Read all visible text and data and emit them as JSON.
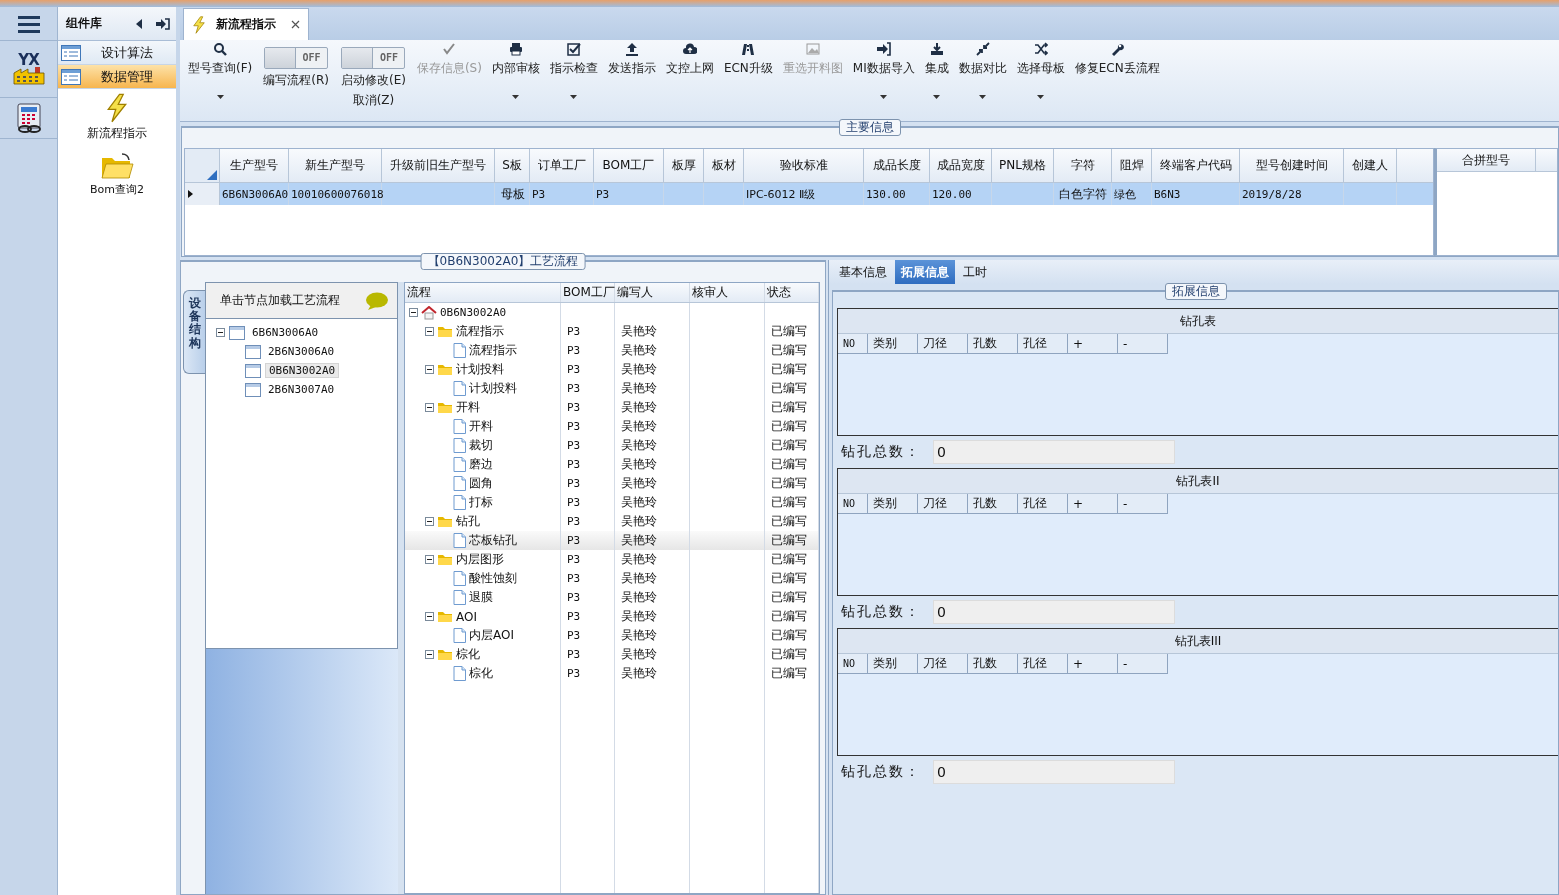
{
  "rail": {
    "logo_text": "YX"
  },
  "component_panel": {
    "title": "组件库",
    "items": [
      {
        "label": "设计算法",
        "selected": false
      },
      {
        "label": "数据管理",
        "selected": true
      }
    ],
    "shortcuts": [
      {
        "label": "新流程指示",
        "kind": "bolt"
      },
      {
        "label": "Bom查询2",
        "kind": "folder"
      }
    ]
  },
  "doc_tabs": [
    {
      "label": "新流程指示",
      "selected": true
    }
  ],
  "toolbar": {
    "items": [
      {
        "kind": "button",
        "label": "型号查询(F)",
        "dropdown": true,
        "disabled": false
      },
      {
        "kind": "toggle",
        "toggle_text": "OFF",
        "on": false,
        "lines": [
          "编写流程(R)"
        ]
      },
      {
        "kind": "toggle",
        "toggle_text": "OFF",
        "on": false,
        "lines": [
          "启动修改(E)",
          "取消(Z)"
        ]
      },
      {
        "kind": "button",
        "label": "保存信息(S)",
        "dropdown": false,
        "disabled": true
      },
      {
        "kind": "button",
        "label": "内部审核",
        "dropdown": true,
        "disabled": false
      },
      {
        "kind": "button",
        "label": "指示检查",
        "dropdown": true,
        "disabled": false
      },
      {
        "kind": "button",
        "label": "发送指示",
        "dropdown": false,
        "disabled": false
      },
      {
        "kind": "button",
        "label": "文控上网",
        "dropdown": false,
        "disabled": false
      },
      {
        "kind": "button",
        "label": "ECN升级",
        "dropdown": false,
        "disabled": false
      },
      {
        "kind": "button",
        "label": "重选开料图",
        "dropdown": false,
        "disabled": true
      },
      {
        "kind": "button",
        "label": "MI数据导入",
        "dropdown": true,
        "disabled": false
      },
      {
        "kind": "button",
        "label": "集成",
        "dropdown": true,
        "disabled": false
      },
      {
        "kind": "button",
        "label": "数据对比",
        "dropdown": true,
        "disabled": false
      },
      {
        "kind": "button",
        "label": "选择母板",
        "dropdown": true,
        "disabled": false
      },
      {
        "kind": "button",
        "label": "修复ECN丢流程",
        "dropdown": false,
        "disabled": false
      }
    ]
  },
  "main_info": {
    "title": "主要信息",
    "columns": [
      "生产型号",
      "新生产型号",
      "升级前旧生产型号",
      "S板",
      "订单工厂",
      "BOM工厂",
      "板厚",
      "板材",
      "验收标准",
      "成品长度",
      "成品宽度",
      "PNL规格",
      "字符",
      "阻焊",
      "终端客户代码",
      "型号创建时间",
      "创建人"
    ],
    "rows": [
      {
        "selected": true,
        "cells": [
          "6B6N3006A0",
          "10010600076018",
          null,
          "母板",
          "P3",
          "P3",
          null,
          null,
          "IPC-6012 Ⅱ级",
          "130.00",
          "120.00",
          null,
          "白色字符",
          "绿色",
          "B6N3",
          "2019/8/28",
          null
        ]
      }
    ],
    "side_columns": [
      "合拼型号"
    ]
  },
  "flow_group": {
    "title": "【0B6N3002A0】工艺流程",
    "side_tab": "设备结构",
    "device_tree": {
      "hint": "单击节点加载工艺流程",
      "nodes": [
        {
          "label": "6B6N3006A0",
          "expanded": true,
          "selected": false,
          "children": [
            {
              "label": "2B6N3006A0",
              "selected": false
            },
            {
              "label": "0B6N3002A0",
              "selected": true
            },
            {
              "label": "2B6N3007A0",
              "selected": false
            }
          ]
        }
      ]
    },
    "flow_table": {
      "columns": [
        "流程",
        "BOM工厂",
        "编写人",
        "核审人",
        "状态"
      ],
      "nodes": [
        {
          "kind": "root",
          "label": "0B6N3002A0",
          "expanded": true,
          "selected": false,
          "children": [
            {
              "kind": "folder",
              "label": "流程指示",
              "bom": "P3",
              "writer": "吴艳玲",
              "status": "已编写",
              "expanded": true,
              "selected": false,
              "children": [
                {
                  "kind": "step",
                  "label": "流程指示",
                  "bom": "P3",
                  "writer": "吴艳玲",
                  "status": "已编写",
                  "selected": false
                }
              ]
            },
            {
              "kind": "folder",
              "label": "计划投料",
              "bom": "P3",
              "writer": "吴艳玲",
              "status": "已编写",
              "expanded": true,
              "selected": false,
              "children": [
                {
                  "kind": "step",
                  "label": "计划投料",
                  "bom": "P3",
                  "writer": "吴艳玲",
                  "status": "已编写",
                  "selected": false
                }
              ]
            },
            {
              "kind": "folder",
              "label": "开料",
              "bom": "P3",
              "writer": "吴艳玲",
              "status": "已编写",
              "expanded": true,
              "selected": false,
              "children": [
                {
                  "kind": "step",
                  "label": "开料",
                  "bom": "P3",
                  "writer": "吴艳玲",
                  "status": "已编写",
                  "selected": false
                },
                {
                  "kind": "step",
                  "label": "裁切",
                  "bom": "P3",
                  "writer": "吴艳玲",
                  "status": "已编写",
                  "selected": false
                },
                {
                  "kind": "step",
                  "label": "磨边",
                  "bom": "P3",
                  "writer": "吴艳玲",
                  "status": "已编写",
                  "selected": false
                },
                {
                  "kind": "step",
                  "label": "圆角",
                  "bom": "P3",
                  "writer": "吴艳玲",
                  "status": "已编写",
                  "selected": false
                },
                {
                  "kind": "step",
                  "label": "打标",
                  "bom": "P3",
                  "writer": "吴艳玲",
                  "status": "已编写",
                  "selected": false
                }
              ]
            },
            {
              "kind": "folder",
              "label": "钻孔",
              "bom": "P3",
              "writer": "吴艳玲",
              "status": "已编写",
              "expanded": true,
              "selected": false,
              "children": [
                {
                  "kind": "step",
                  "label": "芯板钻孔",
                  "bom": "P3",
                  "writer": "吴艳玲",
                  "status": "已编写",
                  "selected": true
                }
              ]
            },
            {
              "kind": "folder",
              "label": "内层图形",
              "bom": "P3",
              "writer": "吴艳玲",
              "status": "已编写",
              "expanded": true,
              "selected": false,
              "children": [
                {
                  "kind": "step",
                  "label": "酸性蚀刻",
                  "bom": "P3",
                  "writer": "吴艳玲",
                  "status": "已编写",
                  "selected": false
                },
                {
                  "kind": "step",
                  "label": "退膜",
                  "bom": "P3",
                  "writer": "吴艳玲",
                  "status": "已编写",
                  "selected": false
                }
              ]
            },
            {
              "kind": "folder",
              "label": "AOI",
              "bom": "P3",
              "writer": "吴艳玲",
              "status": "已编写",
              "expanded": true,
              "selected": false,
              "children": [
                {
                  "kind": "step",
                  "label": "内层AOI",
                  "bom": "P3",
                  "writer": "吴艳玲",
                  "status": "已编写",
                  "selected": false
                }
              ]
            },
            {
              "kind": "folder",
              "label": "棕化",
              "bom": "P3",
              "writer": "吴艳玲",
              "status": "已编写",
              "expanded": true,
              "selected": false,
              "children": [
                {
                  "kind": "step",
                  "label": "棕化",
                  "bom": "P3",
                  "writer": "吴艳玲",
                  "status": "已编写",
                  "selected": false
                }
              ]
            }
          ]
        }
      ]
    }
  },
  "detail": {
    "tabs": [
      {
        "label": "基本信息",
        "selected": false
      },
      {
        "label": "拓展信息",
        "selected": true
      },
      {
        "label": "工时",
        "selected": false
      }
    ],
    "title": "拓展信息",
    "drill_tables": [
      {
        "title": "钻孔表",
        "columns": [
          "NO",
          "类别",
          "刀径",
          "孔数",
          "孔径",
          "+",
          "-"
        ],
        "total_label": "钻孔总数：",
        "total": "0"
      },
      {
        "title": "钻孔表II",
        "columns": [
          "NO",
          "类别",
          "刀径",
          "孔数",
          "孔径",
          "+",
          "-"
        ],
        "total_label": "钻孔总数：",
        "total": "0"
      },
      {
        "title": "钻孔表III",
        "columns": [
          "NO",
          "类别",
          "刀径",
          "孔数",
          "孔径",
          "+",
          "-"
        ],
        "total_label": "钻孔总数：",
        "total": "0"
      }
    ]
  }
}
